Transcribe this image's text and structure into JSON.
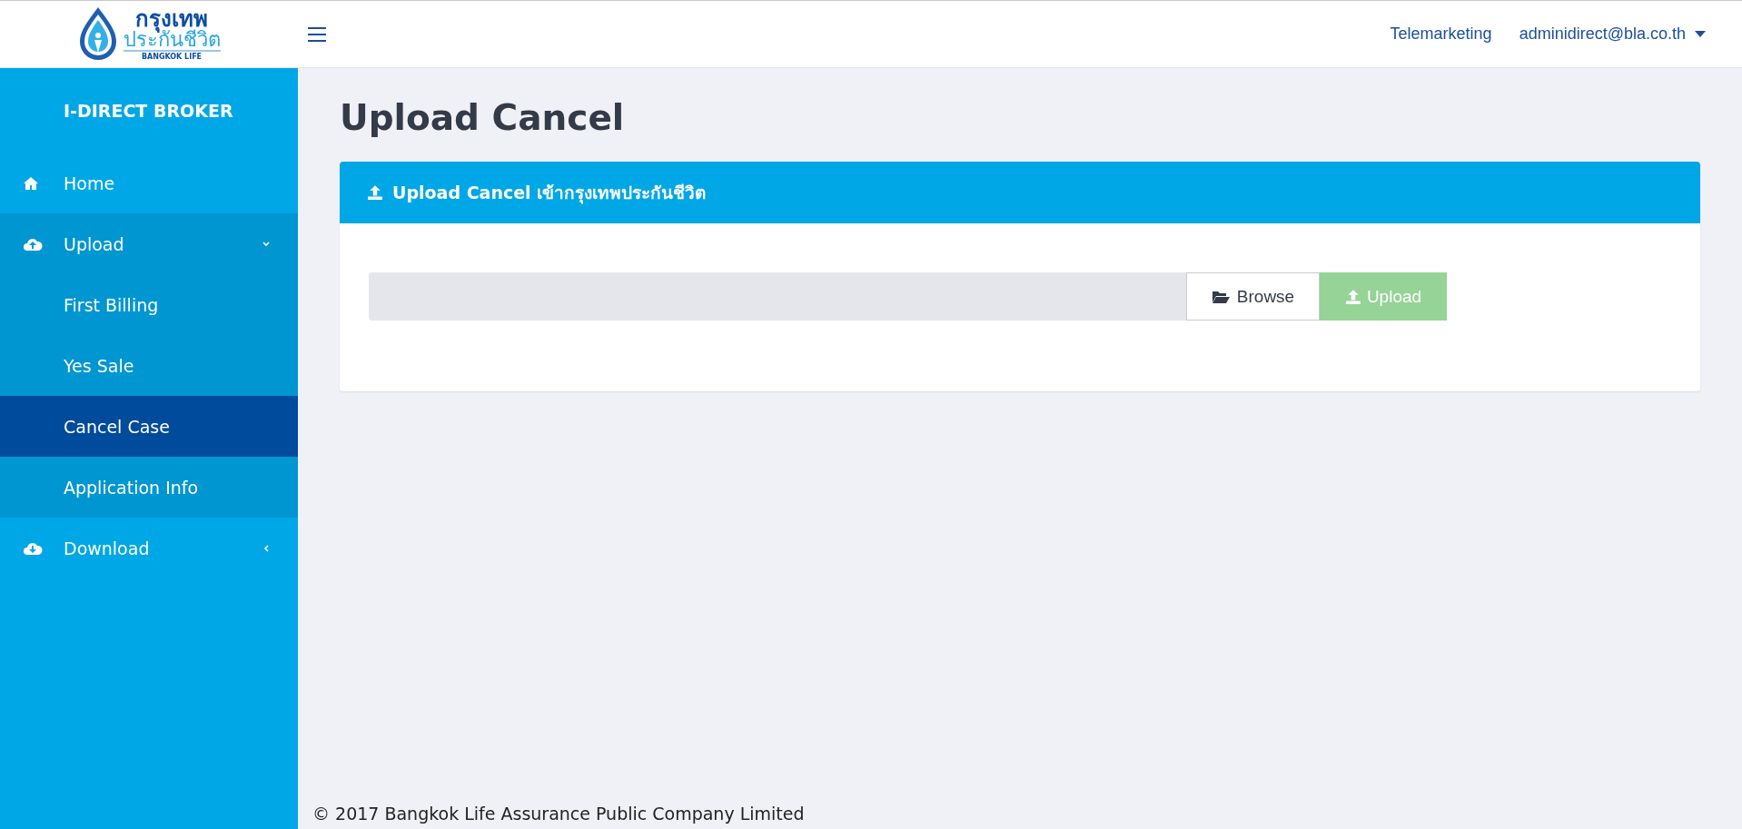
{
  "header": {
    "logo": {
      "thai_line_1": "กรุงเทพ",
      "thai_line_2": "ประกันชีวิต",
      "english": "BANGKOK LIFE"
    },
    "links": [
      "Telemarketing"
    ],
    "user": "adminidirect@bla.co.th"
  },
  "sidebar": {
    "brand": "I-DIRECT BROKER",
    "items": [
      {
        "label": "Home",
        "kind": "home",
        "selected": false
      },
      {
        "label": "Upload",
        "kind": "upload",
        "selected": false,
        "expanded": true,
        "children": [
          {
            "label": "First Billing",
            "selected": false
          },
          {
            "label": "Yes Sale",
            "selected": false
          },
          {
            "label": "Cancel Case",
            "selected": true
          },
          {
            "label": "Application Info",
            "selected": false
          }
        ]
      },
      {
        "label": "Download",
        "kind": "download",
        "selected": false,
        "expanded": false
      }
    ]
  },
  "page_title": "Upload Cancel",
  "panel": {
    "title": "Upload Cancel เข้ากรุงเทพประกันชีวิต",
    "browse_button": "Browse",
    "upload_button": {
      "label": "Upload",
      "disabled": true
    }
  },
  "footer": "© 2017 Bangkok Life Assurance Public Company Limited"
}
